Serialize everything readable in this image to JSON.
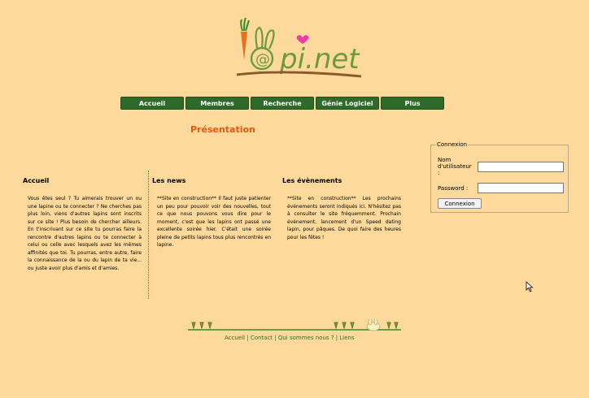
{
  "brand": {
    "logo_text": "pi.net",
    "logo_prefix": "@"
  },
  "nav": [
    "Accueil",
    "Membres",
    "Recherche",
    "Génie Logiciel",
    "Plus"
  ],
  "page": {
    "title": "Présentation"
  },
  "login": {
    "legend": "Connexion",
    "username_label_1": "Nom",
    "username_label_2": "d'utilisateur",
    "username_label_3": ":",
    "password_label": "Password :",
    "button": "Connexion"
  },
  "sections": {
    "accueil": {
      "title": "Accueil",
      "text": "Vous êtes seul ? Tu aimerais trouver un ou une lapine ou te connecter ? Ne cherches pas plus loin, viens d'autres lapins sont inscrits sur ce site ! Plus besoin de chercher ailleurs. En t'inscrivant sur ce site tu pourras faire la rencontre d'autres lapins ou te connecter à celui ou celle avec lesquels avez les mêmes affinités que toi. Tu pourras, entre autre, faire la connaissance de la ou du lapin de ta vie... ou juste avoir plus d'amis et d'amies."
    },
    "news": {
      "title": "Les news",
      "text": "**Site en construction** Il faut juste patienter un peu pour pouvoir voir des nouvelles, tout ce que nous pouvons vous dire pour le moment, c'est que les lapins ont passé une excellente soirée hier. C'était une soirée pleine de petits lapins tous plus rencontrés en lapine."
    },
    "events": {
      "title": "Les évènements",
      "text": "**Site en construction** Les prochains évènements seront indiqués ici. N'hésitez pas à consulter le site fréquemment. Prochain évènement, lancement d'un Speed dating lapin, pour pâques. De quoi faire des heures pour les fêtes !"
    }
  },
  "footer": {
    "links": [
      "Accueil",
      "Contact",
      "Qui sommes nous ?",
      "Liens"
    ],
    "separator": " | "
  },
  "colors": {
    "background": "#fdd99b",
    "nav": "#2e6b2a",
    "title": "#e25a10"
  }
}
